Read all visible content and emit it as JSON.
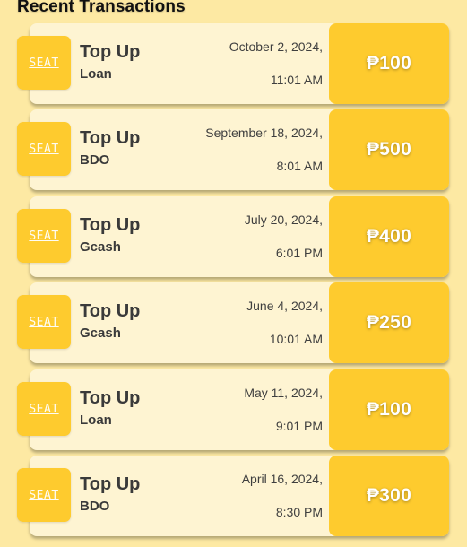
{
  "section": {
    "title": "Recent Transactions"
  },
  "colors": {
    "background": "#fde9a3",
    "card": "#fef4d2",
    "accent": "#fecb2e",
    "text": "#3a3a3a"
  },
  "transactions": [
    {
      "logo": "SEAT",
      "type": "Top Up",
      "source": "Loan",
      "date": "October 2, 2024,",
      "time": "11:01 AM",
      "amount": "₱100"
    },
    {
      "logo": "SEAT",
      "type": "Top Up",
      "source": "BDO",
      "date": "September 18, 2024,",
      "time": "8:01 AM",
      "amount": "₱500"
    },
    {
      "logo": "SEAT",
      "type": "Top Up",
      "source": "Gcash",
      "date": "July 20, 2024,",
      "time": "6:01 PM",
      "amount": "₱400"
    },
    {
      "logo": "SEAT",
      "type": "Top Up",
      "source": "Gcash",
      "date": "June 4, 2024,",
      "time": "10:01 AM",
      "amount": "₱250"
    },
    {
      "logo": "SEAT",
      "type": "Top Up",
      "source": "Loan",
      "date": "May 11, 2024,",
      "time": "9:01 PM",
      "amount": "₱100"
    },
    {
      "logo": "SEAT",
      "type": "Top Up",
      "source": "BDO",
      "date": "April 16, 2024,",
      "time": "8:30 PM",
      "amount": "₱300"
    }
  ]
}
